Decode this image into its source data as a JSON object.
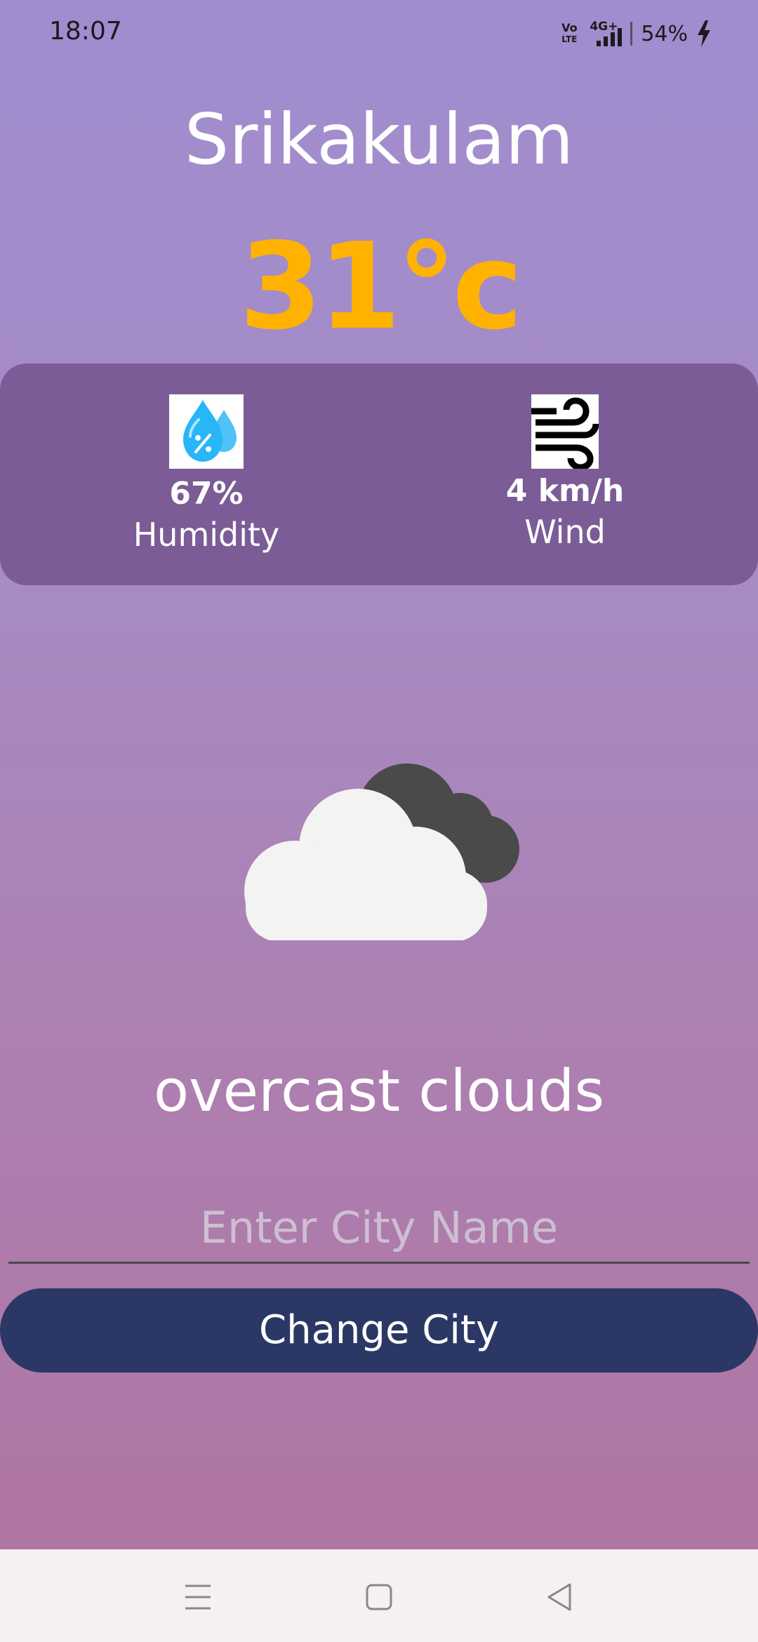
{
  "status_bar": {
    "time": "18:07",
    "volte_top": "Vo",
    "volte_bottom": "LTE",
    "network": "4G+",
    "battery": "54%"
  },
  "weather": {
    "city": "Srikakulam",
    "temperature": "31°c",
    "humidity_value": "67%",
    "humidity_label": "Humidity",
    "wind_value": "4 km/h",
    "wind_label": "Wind",
    "description": "overcast clouds",
    "condition_icon": "overcast-clouds-icon"
  },
  "form": {
    "city_placeholder": "Enter City Name",
    "city_value": "",
    "button_label": "Change City"
  },
  "nav": {
    "icons": [
      "menu-icon",
      "home-icon",
      "back-icon"
    ]
  },
  "colors": {
    "temperature": "#ffb300",
    "card": "#7b5c96",
    "button": "#2b3865"
  }
}
